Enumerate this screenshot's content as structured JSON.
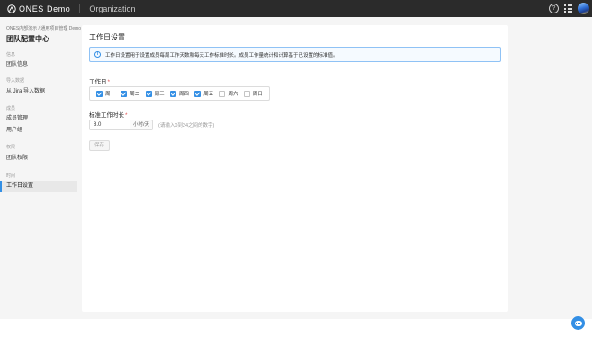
{
  "topbar": {
    "brand": "ONES Demo",
    "org": "Organization"
  },
  "sidebar": {
    "breadcrumb": "ONES内部演示 / 通用项目管理 Demo",
    "title": "团队配置中心",
    "groups": [
      {
        "label": "信息",
        "items": [
          "团队信息"
        ]
      },
      {
        "label": "导入数据",
        "items": [
          "从 Jira 导入数据"
        ]
      },
      {
        "label": "成员",
        "items": [
          "成员管理",
          "用户组"
        ]
      },
      {
        "label": "权限",
        "items": [
          "团队权限"
        ]
      },
      {
        "label": "时间",
        "items": [
          "工作日设置"
        ]
      }
    ],
    "active_item": "工作日设置"
  },
  "main": {
    "title": "工作日设置",
    "info_text": "工作日设置用于设置成员每周工作天数和每天工作标准时长。成员工作量统计和计算基于已设置的标准值。",
    "workdays_label": "工作日",
    "workdays": [
      {
        "label": "周一",
        "checked": true
      },
      {
        "label": "周二",
        "checked": true
      },
      {
        "label": "周三",
        "checked": true
      },
      {
        "label": "周四",
        "checked": true
      },
      {
        "label": "周五",
        "checked": true
      },
      {
        "label": "周六",
        "checked": false
      },
      {
        "label": "周日",
        "checked": false
      }
    ],
    "hours_label": "标准工作时长",
    "hours_value": "8.0",
    "hours_unit": "小时/天",
    "hours_hint": "(请输入0到24之间的数字)",
    "save_label": "保存"
  },
  "colors": {
    "accent": "#338fe5",
    "topbar": "#2b2b2b",
    "required": "#e05252"
  }
}
